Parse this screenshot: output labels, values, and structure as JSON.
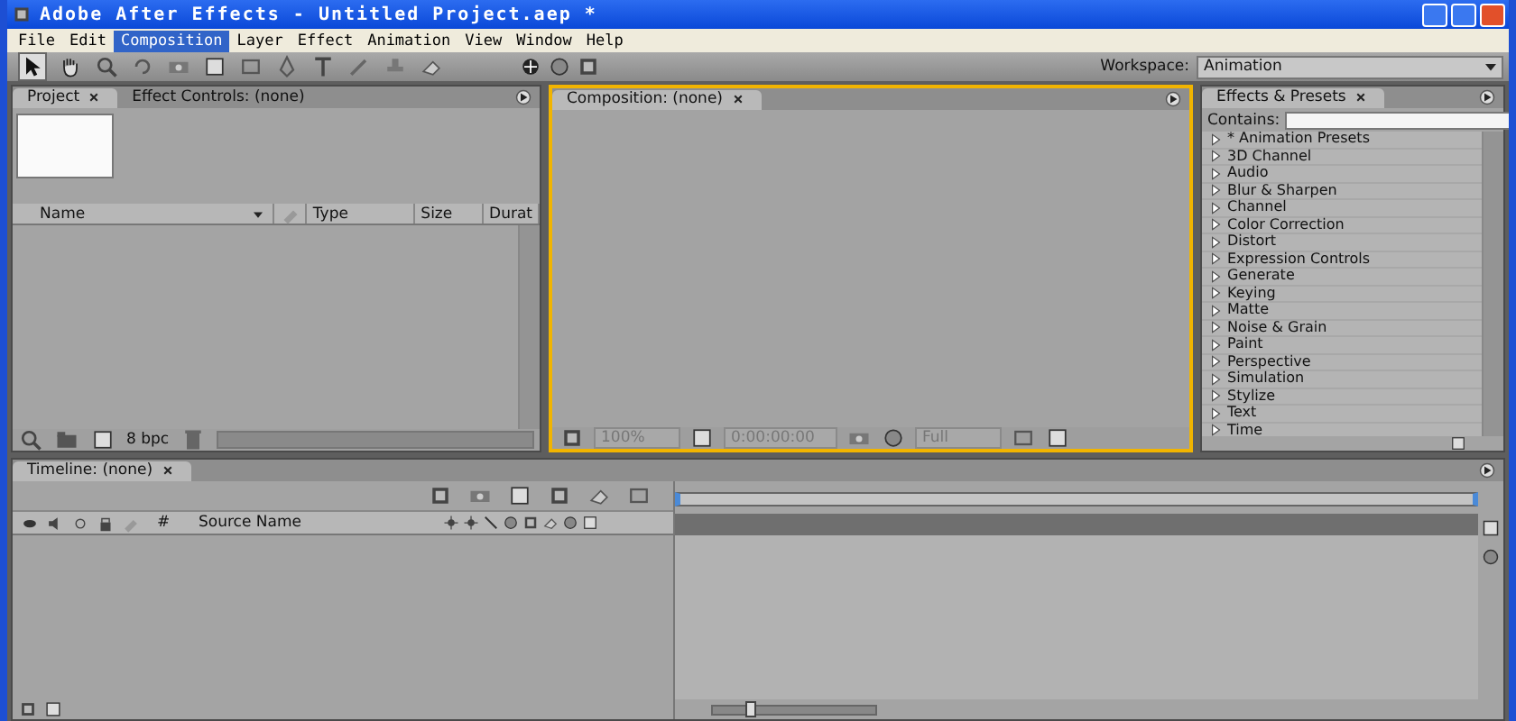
{
  "window": {
    "title": "Adobe After Effects - Untitled Project.aep *"
  },
  "menu": [
    {
      "label": "File",
      "selected": false
    },
    {
      "label": "Edit",
      "selected": false
    },
    {
      "label": "Composition",
      "selected": true
    },
    {
      "label": "Layer",
      "selected": false
    },
    {
      "label": "Effect",
      "selected": false
    },
    {
      "label": "Animation",
      "selected": false
    },
    {
      "label": "View",
      "selected": false
    },
    {
      "label": "Window",
      "selected": false
    },
    {
      "label": "Help",
      "selected": false
    }
  ],
  "toolbar": {
    "workspace_label": "Workspace:",
    "workspace_value": "Animation"
  },
  "project_panel": {
    "tabs": [
      {
        "label": "Project",
        "selected": true
      },
      {
        "label": "Effect Controls: (none)",
        "selected": false
      }
    ],
    "columns": [
      "Name",
      "Type",
      "Size",
      "Durat"
    ],
    "bit_depth": "8 bpc"
  },
  "composition_panel": {
    "tab": "Composition: (none)",
    "zoom": "100%",
    "timecode": "0:00:00:00",
    "resolution": "Full"
  },
  "effects_panel": {
    "tab": "Effects & Presets",
    "search_label": "Contains:",
    "items": [
      "* Animation Presets",
      "3D Channel",
      "Audio",
      "Blur & Sharpen",
      "Channel",
      "Color Correction",
      "Distort",
      "Expression Controls",
      "Generate",
      "Keying",
      "Matte",
      "Noise & Grain",
      "Paint",
      "Perspective",
      "Simulation",
      "Stylize",
      "Text",
      "Time"
    ]
  },
  "timeline_panel": {
    "tab": "Timeline: (none)",
    "columns": [
      "#",
      "Source Name"
    ],
    "zoom_slider": {
      "level": 0.2
    }
  }
}
